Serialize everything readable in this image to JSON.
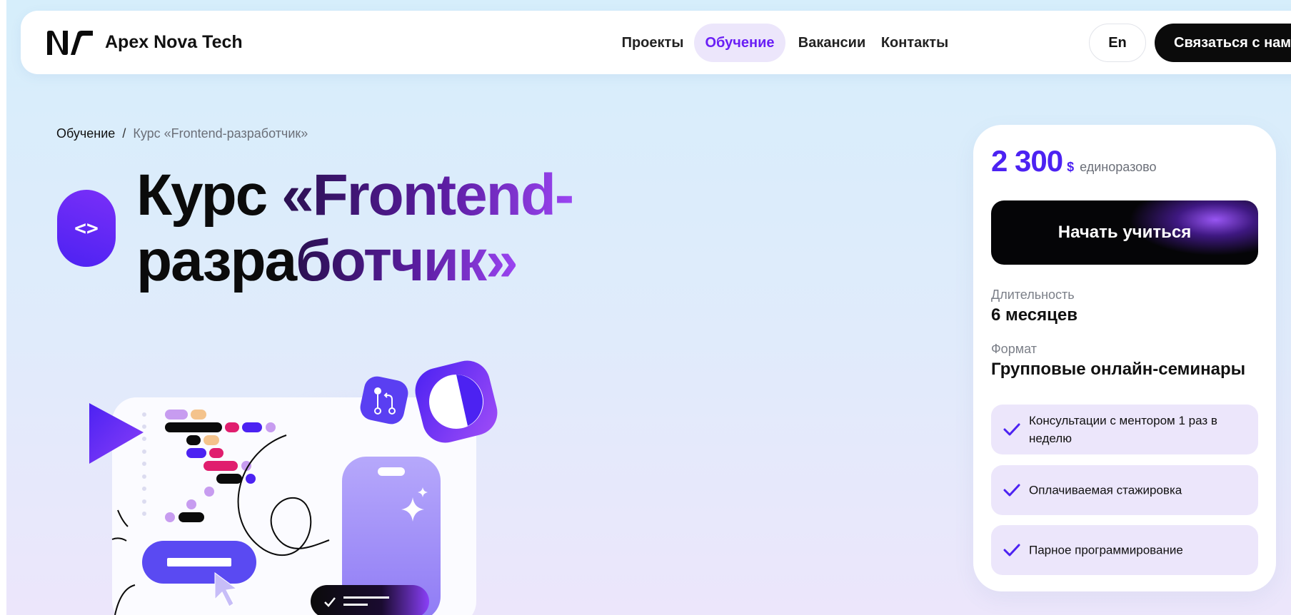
{
  "header": {
    "brand": "Apex Nova Tech",
    "nav": [
      {
        "label": "Проекты",
        "active": false
      },
      {
        "label": "Обучение",
        "active": true
      },
      {
        "label": "Вакансии",
        "active": false
      },
      {
        "label": "Контакты",
        "active": false
      }
    ],
    "lang_label": "En",
    "contact_label": "Связаться с нами",
    "accent_color": "#6a1ff5"
  },
  "breadcrumb": {
    "parent": "Обучение",
    "separator": "/",
    "current": "Курс «Frontend-разработчик»"
  },
  "hero": {
    "icon_glyph": "<>",
    "title_plain": "Курс ",
    "title_accent_line1": "«Frontend-",
    "title_line2_plain": "разра",
    "title_accent_line2": "ботчик»"
  },
  "card": {
    "price": "2 300",
    "currency": "$",
    "price_note": "единоразово",
    "start_label": "Начать учиться",
    "duration_label": "Длительность",
    "duration_value": "6 месяцев",
    "format_label": "Формат",
    "format_value": "Групповые онлайн-семинары",
    "features": [
      "Консультации с ментором 1 раз в неделю",
      "Оплачиваемая стажировка",
      "Парное программирование"
    ],
    "brand_color": "#4c22f2"
  }
}
